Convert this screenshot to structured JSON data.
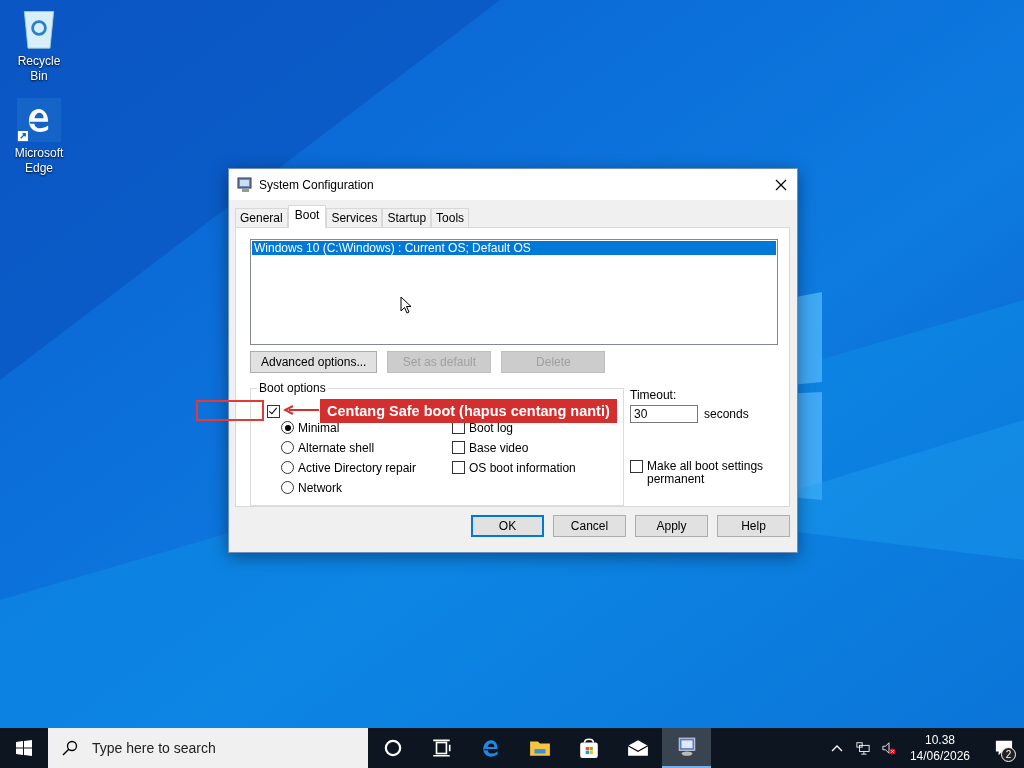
{
  "desktop_icons": [
    {
      "kind": "recycle",
      "label": "Recycle Bin"
    },
    {
      "kind": "edge",
      "label": "Microsoft Edge"
    }
  ],
  "dialog": {
    "title": "System Configuration",
    "tabs": [
      {
        "label": "General",
        "selected": false
      },
      {
        "label": "Boot",
        "selected": true
      },
      {
        "label": "Services",
        "selected": false
      },
      {
        "label": "Startup",
        "selected": false
      },
      {
        "label": "Tools",
        "selected": false
      }
    ],
    "boot_entries": [
      {
        "text": "Windows 10 (C:\\Windows) : Current OS; Default OS",
        "selected": true
      }
    ],
    "list_buttons": [
      {
        "label": "Advanced options...",
        "disabled": false
      },
      {
        "label": "Set as default",
        "disabled": true
      },
      {
        "label": "Delete",
        "disabled": true
      }
    ],
    "boot_options": {
      "legend": "Boot options",
      "safe_boot": {
        "checked": true
      },
      "radios": [
        {
          "label": "Minimal",
          "selected": true
        },
        {
          "label": "Alternate shell",
          "selected": false
        },
        {
          "label": "Active Directory repair",
          "selected": false
        },
        {
          "label": "Network",
          "selected": false
        }
      ],
      "checks": [
        {
          "label": "Boot log",
          "checked": false
        },
        {
          "label": "Base video",
          "checked": false
        },
        {
          "label": "OS boot information",
          "checked": false
        }
      ]
    },
    "timeout": {
      "label": "Timeout:",
      "value": "30",
      "unit": "seconds"
    },
    "make_permanent": {
      "label": "Make all boot settings permanent",
      "checked": false
    },
    "buttons": [
      {
        "label": "OK",
        "default": true
      },
      {
        "label": "Cancel",
        "default": false
      },
      {
        "label": "Apply",
        "default": false
      },
      {
        "label": "Help",
        "default": false
      }
    ]
  },
  "annotation": {
    "text": "Centang Safe boot (hapus centang nanti)"
  },
  "taskbar": {
    "search_placeholder": "Type here to search",
    "apps": [
      {
        "kind": "cortana",
        "active": false
      },
      {
        "kind": "taskview",
        "active": false
      },
      {
        "kind": "edge",
        "active": false
      },
      {
        "kind": "folder",
        "active": false
      },
      {
        "kind": "store",
        "active": false
      },
      {
        "kind": "mail",
        "active": false
      },
      {
        "kind": "msconfig",
        "active": true
      }
    ],
    "time": "10.38",
    "date": "14/06/2026",
    "notifications": "2"
  }
}
